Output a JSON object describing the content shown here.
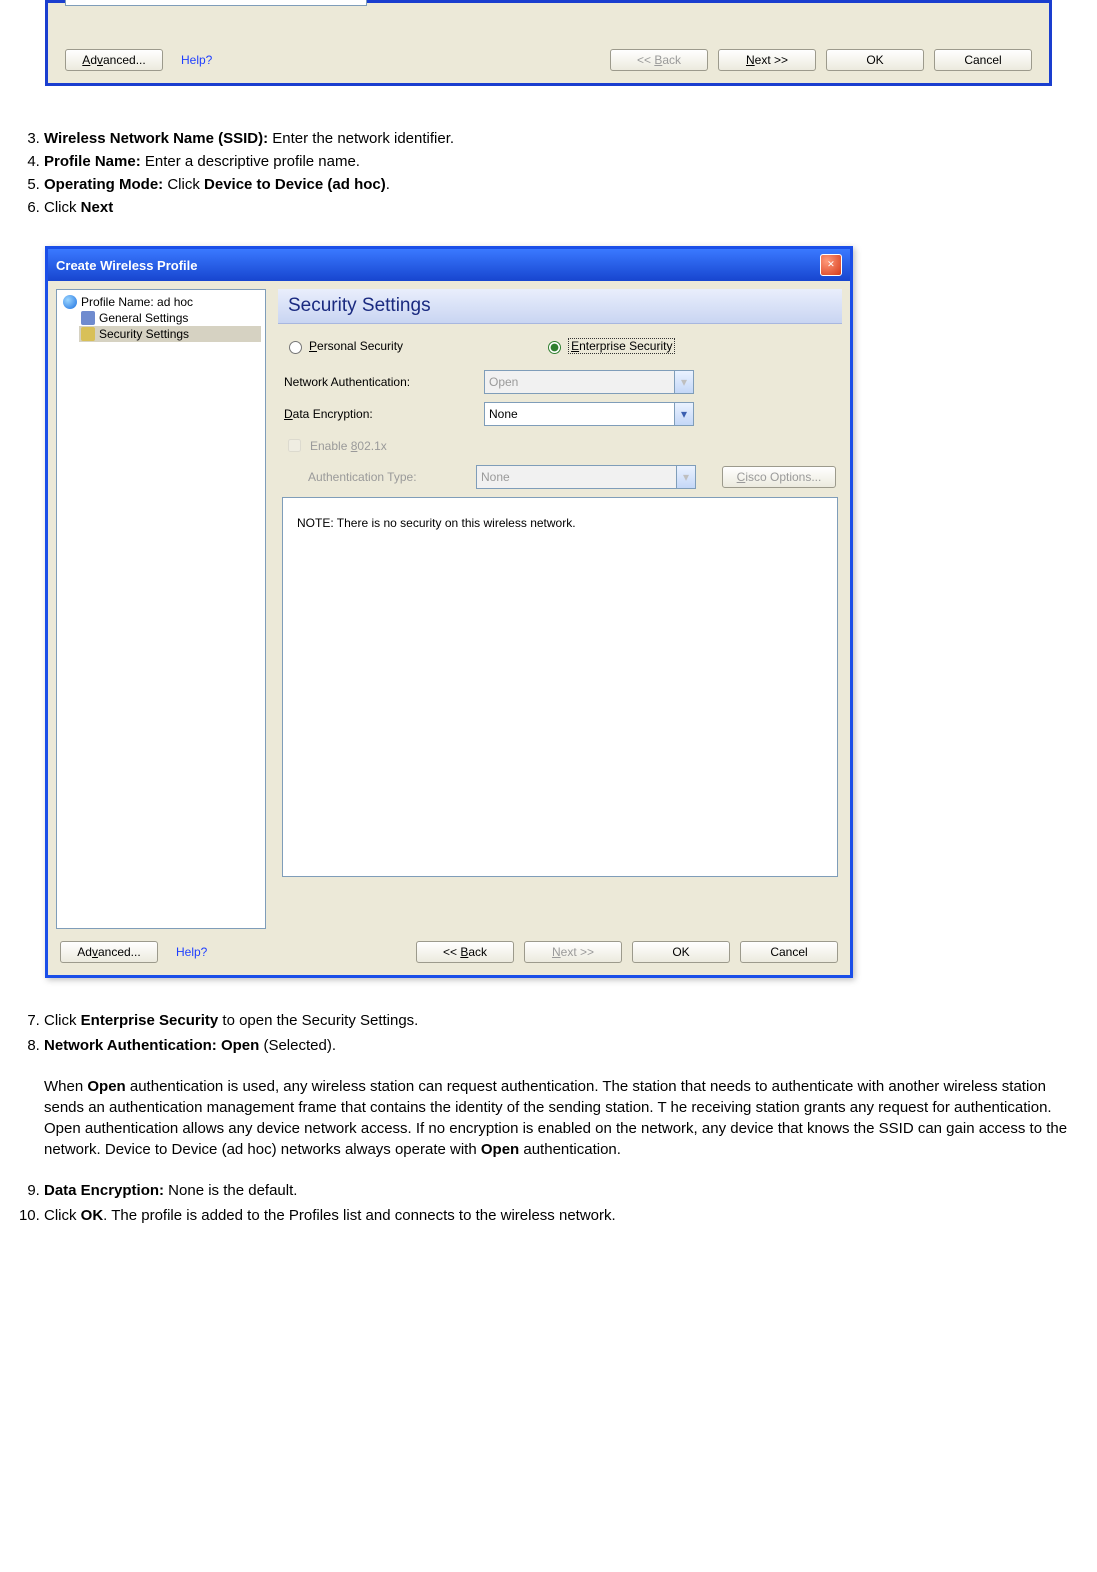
{
  "top_dialog": {
    "advanced": "Advanced...",
    "help": "Help?",
    "back": "<< Back",
    "next": "Next >>",
    "ok": "OK",
    "cancel": "Cancel"
  },
  "steps_top": {
    "s3_bold": "Wireless Network Name (SSID):",
    "s3_rest": " Enter the network identifier.",
    "s4_bold": "Profile Name:",
    "s4_rest": " Enter a descriptive profile name.",
    "s5_bold_a": "Operating Mode:",
    "s5_mid": " Click ",
    "s5_bold_b": "Device to Device (ad hoc)",
    "s5_end": ".",
    "s6_a": "Click ",
    "s6_b": "Next"
  },
  "dialog": {
    "title": "Create Wireless Profile",
    "nav": {
      "profile": "Profile Name: ad hoc",
      "general": "General Settings",
      "security": "Security Settings"
    },
    "section_header": "Security Settings",
    "radio_personal": "Personal Security",
    "radio_enterprise": "Enterprise Security",
    "lbl_netauth": "Network Authentication:",
    "val_netauth": "Open",
    "lbl_dataenc": "Data Encryption:",
    "val_dataenc": "None",
    "chk_enable8021x": "Enable 802.1x",
    "lbl_authtype": "Authentication Type:",
    "val_authtype": "None",
    "btn_cisco": "Cisco Options...",
    "note": "NOTE: There is no security on this wireless network.",
    "advanced": "Advanced...",
    "help": "Help?",
    "back": "<< Back",
    "next": "Next >>",
    "ok": "OK",
    "cancel": "Cancel"
  },
  "steps_bottom": {
    "s7_a": "Click ",
    "s7_b": "Enterprise Security",
    "s7_c": " to open the Security Settings.",
    "s8_bold": "Network Authentication: Open",
    "s8_rest": " (Selected).",
    "s8_para_a": "When ",
    "s8_para_b": "Open",
    "s8_para_c": " authentication is used, any wireless station can request authentication. The station that needs to authenticate with another wireless station sends an authentication management frame that contains the identity of the sending station. T he receiving station grants any request for authentication. Open authentication allows any device network access. If no encryption is enabled on the network, any device that knows the SSID can gain access to the network. Device to Device (ad hoc) networks always operate with ",
    "s8_para_d": "Open",
    "s8_para_e": " authentication.",
    "s9_bold": "Data Encryption:",
    "s9_rest": " None is the default.",
    "s10_a": "Click ",
    "s10_b": "OK",
    "s10_c": ". The profile is added to the Profiles list and connects to the wireless network."
  }
}
